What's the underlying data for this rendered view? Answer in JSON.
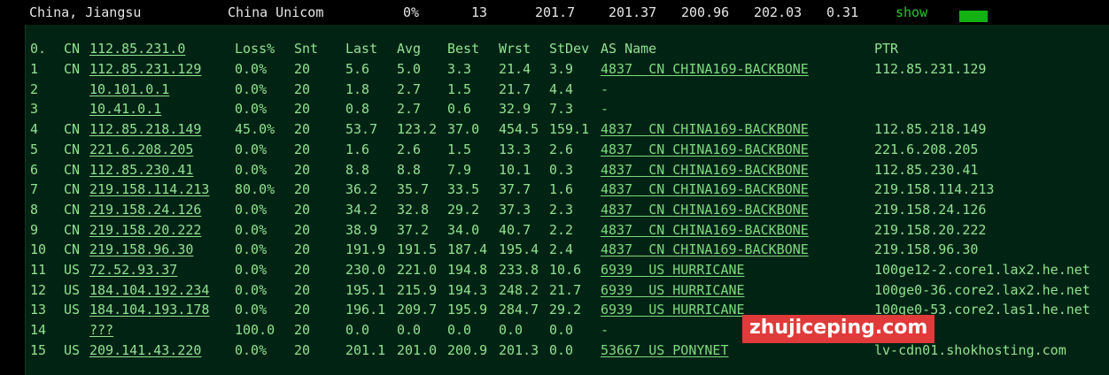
{
  "header": {
    "location": "China, Jiangsu",
    "isp": "China Unicom",
    "loss": "0%",
    "sent": "13",
    "last": "201.7",
    "avg": "201.37",
    "best": "200.96",
    "worst": "202.03",
    "stdev": "0.31",
    "show_label": "show"
  },
  "table": {
    "headers": [
      "0.",
      "CN",
      "112.85.231.0",
      "Loss%",
      "Snt",
      "Last",
      "Avg",
      "Best",
      "Wrst",
      "StDev",
      "AS Name",
      "PTR"
    ],
    "rows": [
      {
        "n": "1",
        "cc": "CN",
        "ip": "112.85.231.129",
        "loss": "0.0%",
        "snt": "20",
        "last": "5.6",
        "avg": "5.0",
        "best": "3.3",
        "wrst": "21.4",
        "stdev": "3.9",
        "asn": "4837",
        "as_cc": "CN",
        "as_name": "CHINA169-BACKBONE",
        "ptr": "112.85.231.129"
      },
      {
        "n": "2",
        "cc": "",
        "ip": "10.101.0.1",
        "loss": "0.0%",
        "snt": "20",
        "last": "1.8",
        "avg": "2.7",
        "best": "1.5",
        "wrst": "21.7",
        "stdev": "4.4",
        "asn": "-",
        "as_cc": "",
        "as_name": "",
        "ptr": ""
      },
      {
        "n": "3",
        "cc": "",
        "ip": "10.41.0.1",
        "loss": "0.0%",
        "snt": "20",
        "last": "0.8",
        "avg": "2.7",
        "best": "0.6",
        "wrst": "32.9",
        "stdev": "7.3",
        "asn": "-",
        "as_cc": "",
        "as_name": "",
        "ptr": ""
      },
      {
        "n": "4",
        "cc": "CN",
        "ip": "112.85.218.149",
        "loss": "45.0%",
        "snt": "20",
        "last": "53.7",
        "avg": "123.2",
        "best": "37.0",
        "wrst": "454.5",
        "stdev": "159.1",
        "asn": "4837",
        "as_cc": "CN",
        "as_name": "CHINA169-BACKBONE",
        "ptr": "112.85.218.149"
      },
      {
        "n": "5",
        "cc": "CN",
        "ip": "221.6.208.205",
        "loss": "0.0%",
        "snt": "20",
        "last": "1.6",
        "avg": "2.6",
        "best": "1.5",
        "wrst": "13.3",
        "stdev": "2.6",
        "asn": "4837",
        "as_cc": "CN",
        "as_name": "CHINA169-BACKBONE",
        "ptr": "221.6.208.205"
      },
      {
        "n": "6",
        "cc": "CN",
        "ip": "112.85.230.41",
        "loss": "0.0%",
        "snt": "20",
        "last": "8.8",
        "avg": "8.8",
        "best": "7.9",
        "wrst": "10.1",
        "stdev": "0.3",
        "asn": "4837",
        "as_cc": "CN",
        "as_name": "CHINA169-BACKBONE",
        "ptr": "112.85.230.41"
      },
      {
        "n": "7",
        "cc": "CN",
        "ip": "219.158.114.213",
        "loss": "80.0%",
        "snt": "20",
        "last": "36.2",
        "avg": "35.7",
        "best": "33.5",
        "wrst": "37.7",
        "stdev": "1.6",
        "asn": "4837",
        "as_cc": "CN",
        "as_name": "CHINA169-BACKBONE",
        "ptr": "219.158.114.213"
      },
      {
        "n": "8",
        "cc": "CN",
        "ip": "219.158.24.126",
        "loss": "0.0%",
        "snt": "20",
        "last": "34.2",
        "avg": "32.8",
        "best": "29.2",
        "wrst": "37.3",
        "stdev": "2.3",
        "asn": "4837",
        "as_cc": "CN",
        "as_name": "CHINA169-BACKBONE",
        "ptr": "219.158.24.126"
      },
      {
        "n": "9",
        "cc": "CN",
        "ip": "219.158.20.222",
        "loss": "0.0%",
        "snt": "20",
        "last": "38.9",
        "avg": "37.2",
        "best": "34.0",
        "wrst": "40.7",
        "stdev": "2.2",
        "asn": "4837",
        "as_cc": "CN",
        "as_name": "CHINA169-BACKBONE",
        "ptr": "219.158.20.222"
      },
      {
        "n": "10",
        "cc": "CN",
        "ip": "219.158.96.30",
        "loss": "0.0%",
        "snt": "20",
        "last": "191.9",
        "avg": "191.5",
        "best": "187.4",
        "wrst": "195.4",
        "stdev": "2.4",
        "asn": "4837",
        "as_cc": "CN",
        "as_name": "CHINA169-BACKBONE",
        "ptr": "219.158.96.30"
      },
      {
        "n": "11",
        "cc": "US",
        "ip": "72.52.93.37",
        "loss": "0.0%",
        "snt": "20",
        "last": "230.0",
        "avg": "221.0",
        "best": "194.8",
        "wrst": "233.8",
        "stdev": "10.6",
        "asn": "6939",
        "as_cc": "US",
        "as_name": "HURRICANE",
        "ptr": "100ge12-2.core1.lax2.he.net"
      },
      {
        "n": "12",
        "cc": "US",
        "ip": "184.104.192.234",
        "loss": "0.0%",
        "snt": "20",
        "last": "195.1",
        "avg": "215.9",
        "best": "194.3",
        "wrst": "248.2",
        "stdev": "21.7",
        "asn": "6939",
        "as_cc": "US",
        "as_name": "HURRICANE",
        "ptr": "100ge0-36.core2.lax2.he.net"
      },
      {
        "n": "13",
        "cc": "US",
        "ip": "184.104.193.178",
        "loss": "0.0%",
        "snt": "20",
        "last": "196.1",
        "avg": "209.7",
        "best": "195.9",
        "wrst": "284.7",
        "stdev": "29.2",
        "asn": "6939",
        "as_cc": "US",
        "as_name": "HURRICANE",
        "ptr": "100ge0-53.core2.las1.he.net"
      },
      {
        "n": "14",
        "cc": "",
        "ip": "???",
        "loss": "100.0",
        "snt": "20",
        "last": "0.0",
        "avg": "0.0",
        "best": "0.0",
        "wrst": "0.0",
        "stdev": "0.0",
        "asn": "-",
        "as_cc": "",
        "as_name": "",
        "ptr": ""
      },
      {
        "n": "15",
        "cc": "US",
        "ip": "209.141.43.220",
        "loss": "0.0%",
        "snt": "20",
        "last": "201.1",
        "avg": "201.0",
        "best": "200.9",
        "wrst": "201.3",
        "stdev": "0.0",
        "asn": "53667",
        "as_cc": "US",
        "as_name": "PONYNET",
        "ptr": "lv-cdn01.shokhosting.com"
      }
    ]
  },
  "watermark": "zhujiceping.com",
  "colors": {
    "background": "#000000",
    "terminal": "#002314",
    "text": "#8fe38f",
    "header_text": "#e6e6e6",
    "bar": "#13b113",
    "watermark_bg": "#e03a3a"
  }
}
